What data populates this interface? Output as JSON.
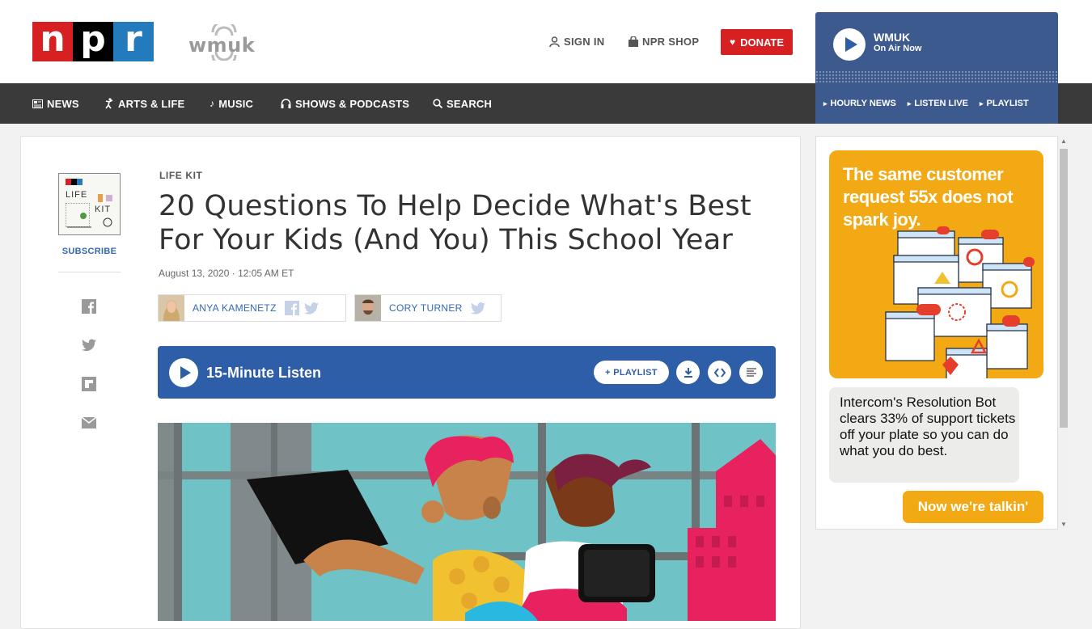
{
  "header": {
    "logo_letters": [
      "n",
      "p",
      "r"
    ],
    "station_logo_text": "wmuk",
    "sign_in": "SIGN IN",
    "shop": "NPR SHOP",
    "donate": "DONATE"
  },
  "on_air": {
    "station": "WMUK",
    "status": "On Air Now"
  },
  "nav": {
    "items": [
      {
        "label": "NEWS",
        "icon": "news-icon"
      },
      {
        "label": "ARTS & LIFE",
        "icon": "arts-icon"
      },
      {
        "label": "MUSIC",
        "icon": "music-note-icon"
      },
      {
        "label": "SHOWS & PODCASTS",
        "icon": "headphones-icon"
      },
      {
        "label": "SEARCH",
        "icon": "search-icon"
      }
    ],
    "station_links": [
      "HOURLY NEWS",
      "LISTEN LIVE",
      "PLAYLIST"
    ]
  },
  "sidebar": {
    "podcast_art_title_1": "LIFE",
    "podcast_art_title_2": "KIT",
    "subscribe": "SUBSCRIBE",
    "share_icons": [
      "facebook-icon",
      "twitter-icon",
      "flipboard-icon",
      "email-icon"
    ]
  },
  "article": {
    "slug": "LIFE KIT",
    "headline": "20 Questions To Help Decide What's Best For Your Kids (And You) This School Year",
    "date": "August 13, 2020 · 12:05 AM ET",
    "authors": [
      {
        "name": "ANYA KAMENETZ",
        "socials": [
          "facebook-icon",
          "twitter-icon"
        ]
      },
      {
        "name": "CORY TURNER",
        "socials": [
          "twitter-icon"
        ]
      }
    ]
  },
  "player": {
    "title": "15-Minute Listen",
    "playlist_button": "+ PLAYLIST",
    "controls": [
      "download-icon",
      "embed-icon",
      "transcript-icon"
    ]
  },
  "ad": {
    "headline": "The same customer request 55x does not spark joy.",
    "body": "Intercom's Resolution Bot clears 33% of support tickets off your plate so you can do what you do best.",
    "cta": "Now we're talkin'"
  },
  "colors": {
    "npr_red": "#d62021",
    "npr_blue": "#237bbd",
    "player_blue": "#2e5ea8",
    "station_blue": "#3d5a8f",
    "ad_orange": "#f2a914"
  }
}
